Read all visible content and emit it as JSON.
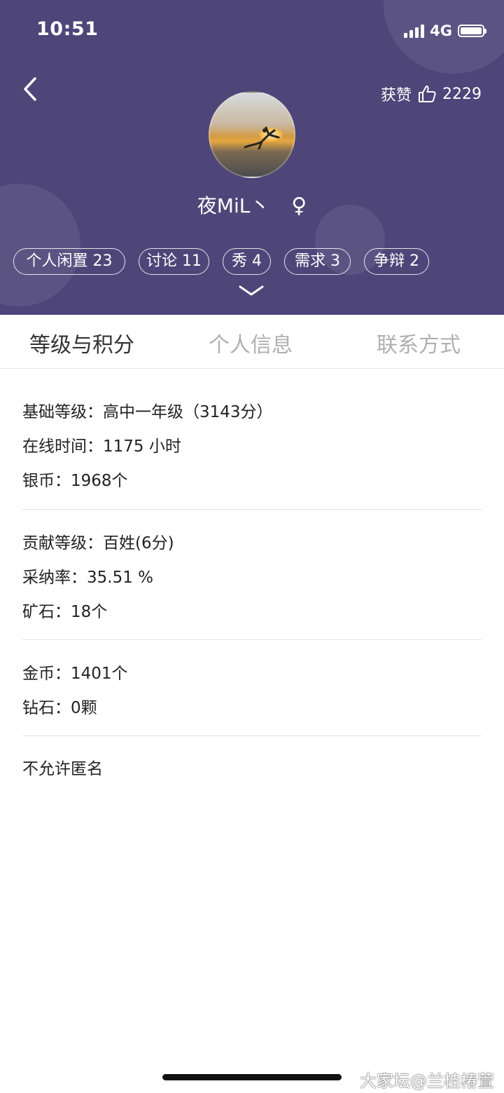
{
  "status_bar": {
    "time": "10:51",
    "network": "4G"
  },
  "header": {
    "likes_label": "获赞",
    "likes_count": "2229",
    "username": "夜MiL丶",
    "gender_symbol": "♀",
    "pills": [
      {
        "label": "个人闲置 23"
      },
      {
        "label": "讨论 11"
      },
      {
        "label": "秀 4"
      },
      {
        "label": "需求 3"
      },
      {
        "label": "争辩 2"
      }
    ]
  },
  "tabs": [
    {
      "label": "等级与积分",
      "active": true
    },
    {
      "label": "个人信息",
      "active": false
    },
    {
      "label": "联系方式",
      "active": false
    }
  ],
  "stats": {
    "basic_level": "基础等级：高中一年级（3143分）",
    "online_time": "在线时间：1175 小时",
    "silver": "银币：1968个",
    "contribution_level": "贡献等级：百姓(6分)",
    "adoption_rate": "采纳率：35.51 %",
    "ore": "矿石：18个",
    "gold": "金币：1401个",
    "diamond": "钻石：0颗",
    "anonymous": "不允许匿名"
  },
  "watermark": "大家坛@兰桂椿萱",
  "colors": {
    "header_bg": "#4e4679",
    "active_tab": "#333333",
    "inactive_tab": "#b0b0b0"
  }
}
